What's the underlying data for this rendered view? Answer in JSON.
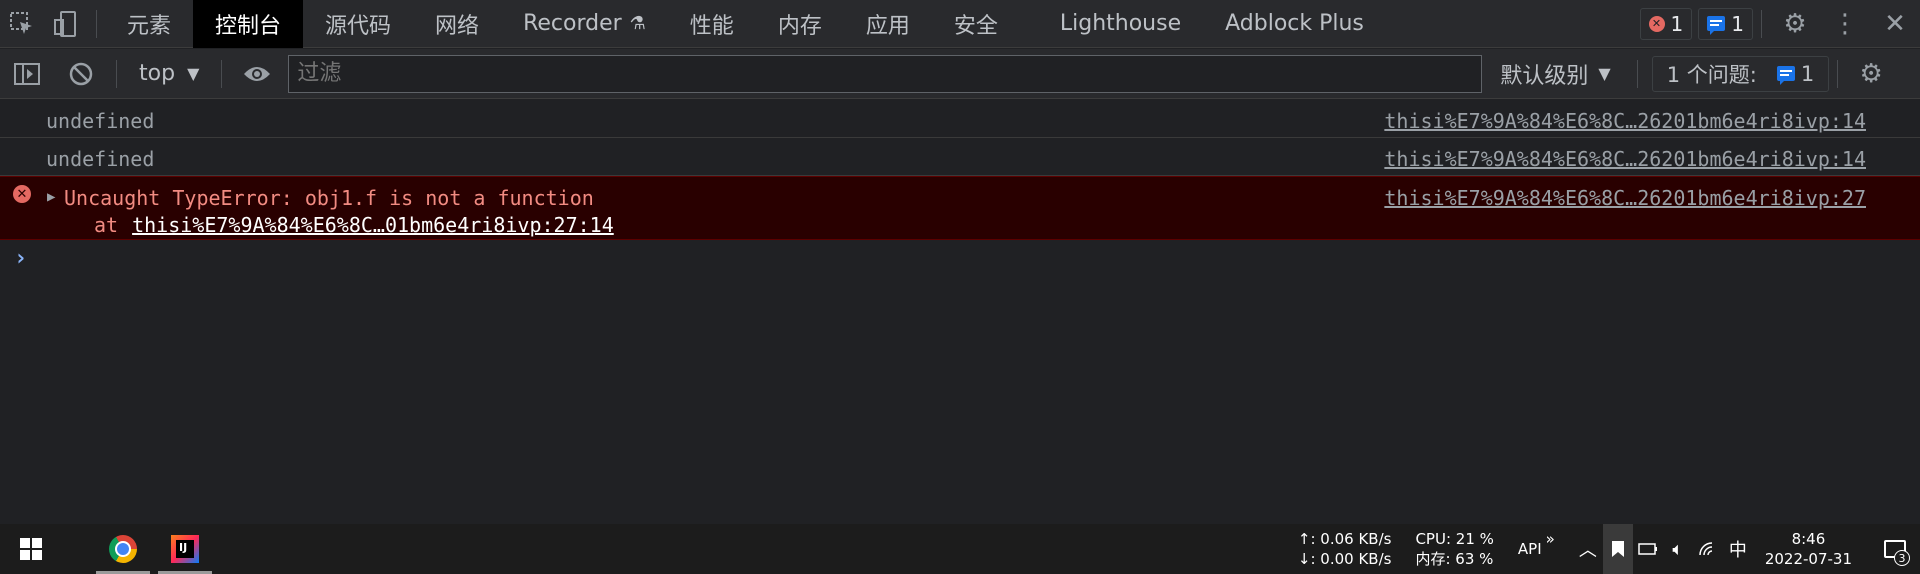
{
  "tabs": [
    {
      "label": "元素"
    },
    {
      "label": "控制台"
    },
    {
      "label": "源代码"
    },
    {
      "label": "网络"
    },
    {
      "label": "Recorder"
    },
    {
      "label": "性能"
    },
    {
      "label": "内存"
    },
    {
      "label": "应用"
    },
    {
      "label": "安全"
    },
    {
      "label": "Lighthouse"
    },
    {
      "label": "Adblock Plus"
    }
  ],
  "counters": {
    "errors": "1",
    "messages": "1"
  },
  "toolbar": {
    "context": "top",
    "filter_placeholder": "过滤",
    "level": "默认级别",
    "issues_label": "1 个问题:",
    "issues_count": "1"
  },
  "console": {
    "rows": [
      {
        "message": "undefined",
        "source": "thisi%E7%9A%84%E6%8C…26201bm6e4ri8ivp:14"
      },
      {
        "message": "undefined",
        "source": "thisi%E7%9A%84%E6%8C…26201bm6e4ri8ivp:14"
      }
    ],
    "error": {
      "message": "Uncaught TypeError: obj1.f is not a function",
      "source": "thisi%E7%9A%84%E6%8C…26201bm6e4ri8ivp:27",
      "stack_prefix": "at",
      "stack_link": "thisi%E7%9A%84%E6%8C…01bm6e4ri8ivp:27:14"
    },
    "prompt": "›"
  },
  "taskbar": {
    "net_up": "↑: 0.06 KB/s",
    "net_down": "↓: 0.00 KB/s",
    "cpu": "CPU: 21 %",
    "mem": "内存: 63 %",
    "api": "API",
    "expand": "»",
    "ime": "中",
    "time": "8:46",
    "date": "2022-07-31",
    "notifications": "3",
    "ij_letters": "IJ"
  },
  "colors": {
    "error_text": "#f28b82",
    "error_bg": "#290000",
    "accent_blue": "#1a73e8",
    "panel_bg": "#202124"
  }
}
